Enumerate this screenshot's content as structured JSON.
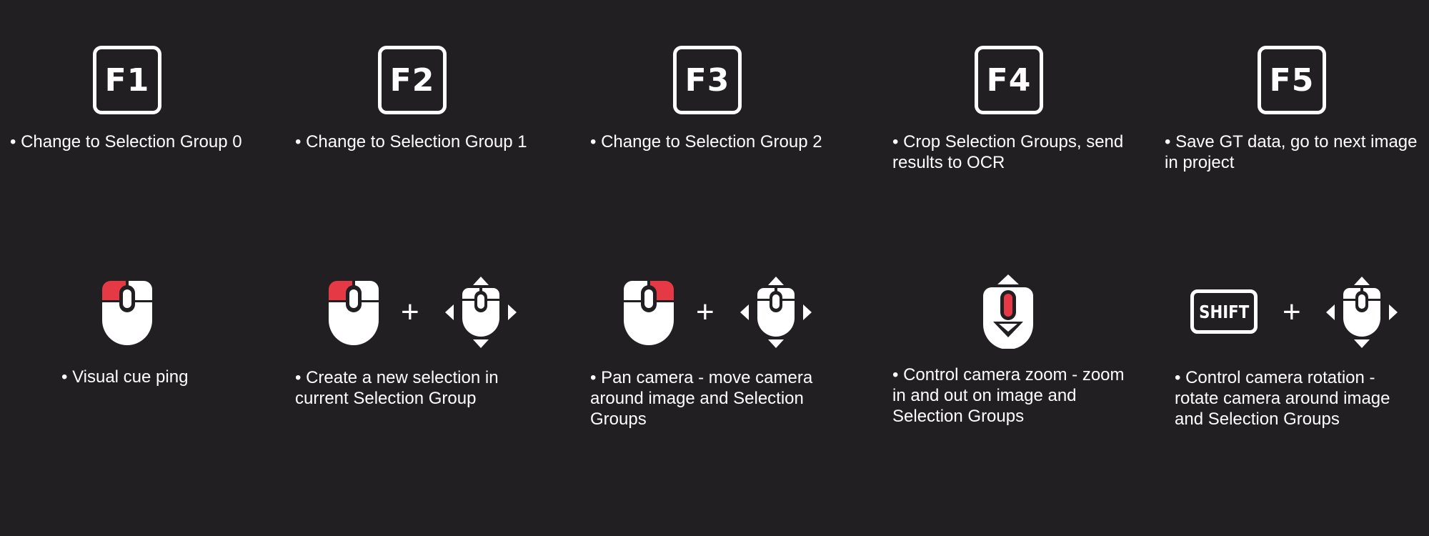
{
  "colors": {
    "background": "#211f21",
    "foreground": "#ffffff",
    "accent": "#e63946"
  },
  "function_keys": [
    {
      "key": "F1",
      "description": "• Change to Selection Group 0"
    },
    {
      "key": "F2",
      "description": "• Change to Selection Group 1"
    },
    {
      "key": "F3",
      "description": "• Change to Selection Group 2"
    },
    {
      "key": "F4",
      "description": "• Crop Selection Groups, send results to OCR"
    },
    {
      "key": "F5",
      "description": "• Save GT data, go to next image in project"
    }
  ],
  "mouse_controls": [
    {
      "icons": [
        "mouse-left-click-icon"
      ],
      "description": "• Visual cue ping"
    },
    {
      "icons": [
        "mouse-left-click-icon",
        "mouse-move-icon"
      ],
      "description": "• Create a new selection in current Selection Group"
    },
    {
      "icons": [
        "mouse-right-click-icon",
        "mouse-move-icon"
      ],
      "description": "• Pan camera - move camera around image and Selection Groups"
    },
    {
      "icons": [
        "mouse-scroll-icon"
      ],
      "description": "• Control camera zoom - zoom in and out on image and Selection Groups"
    },
    {
      "icons": [
        "shift-key-icon",
        "mouse-move-icon"
      ],
      "description": "• Control camera rotation - rotate camera around image and Selection Groups"
    }
  ],
  "plus_sign": "+",
  "shift_label": "SHIFT"
}
